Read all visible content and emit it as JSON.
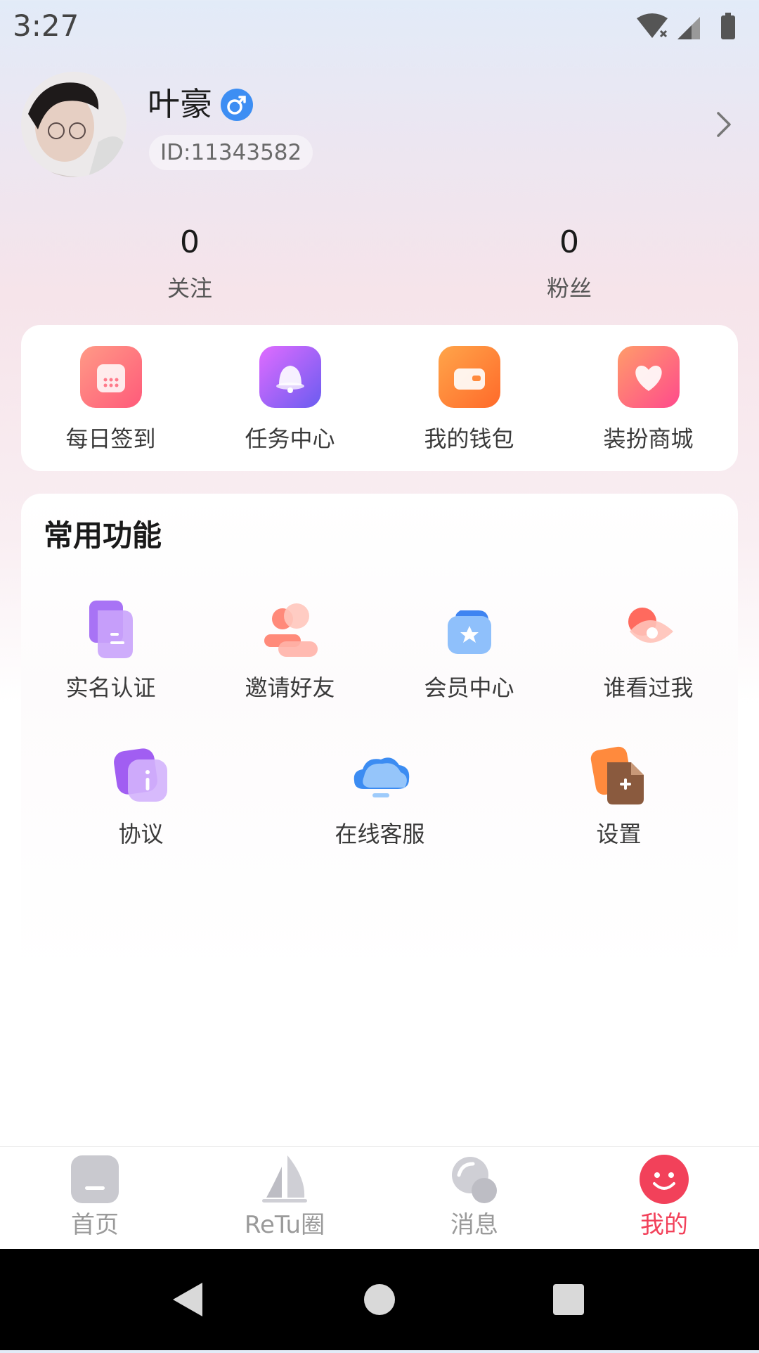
{
  "status_bar": {
    "time": "3:27"
  },
  "profile": {
    "name": "叶豪",
    "gender_symbol": "♂",
    "id_text": "ID:11343582"
  },
  "stats": [
    {
      "value": "0",
      "label": "关注"
    },
    {
      "value": "0",
      "label": "粉丝"
    }
  ],
  "quick_actions": [
    {
      "label": "每日签到",
      "icon": "calendar-icon"
    },
    {
      "label": "任务中心",
      "icon": "bell-icon"
    },
    {
      "label": "我的钱包",
      "icon": "wallet-icon"
    },
    {
      "label": "装扮商城",
      "icon": "heart-icon"
    }
  ],
  "features": {
    "title": "常用功能",
    "items": [
      {
        "label": "实名认证",
        "icon": "id-document-icon"
      },
      {
        "label": "邀请好友",
        "icon": "invite-people-icon"
      },
      {
        "label": "会员中心",
        "icon": "vip-star-icon"
      },
      {
        "label": "谁看过我",
        "icon": "eye-icon"
      },
      {
        "label": "协议",
        "icon": "agreement-icon"
      },
      {
        "label": "在线客服",
        "icon": "customer-service-icon"
      },
      {
        "label": "设置",
        "icon": "settings-file-icon"
      }
    ]
  },
  "bottom_nav": [
    {
      "label": "首页",
      "icon": "home-icon",
      "active": false
    },
    {
      "label": "ReTu圈",
      "icon": "sail-icon",
      "active": false
    },
    {
      "label": "消息",
      "icon": "message-bubble-icon",
      "active": false
    },
    {
      "label": "我的",
      "icon": "smiley-icon",
      "active": true
    }
  ],
  "colors": {
    "accent": "#f2415a",
    "gender_blue": "#3d8ef3"
  }
}
